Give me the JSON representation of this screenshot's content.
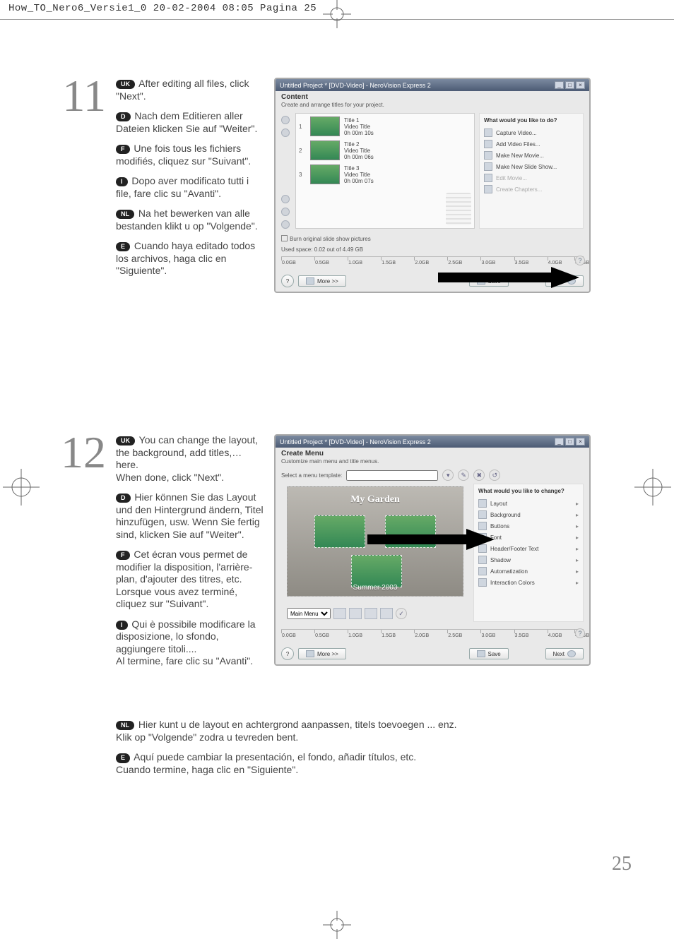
{
  "header": "How_TO_Nero6_Versie1_0   20-02-2004   08:05   Pagina 25",
  "page_number": "25",
  "step11": {
    "number": "11",
    "uk": "After editing all files, click \"Next\".",
    "d": "Nach dem Editieren aller Dateien klicken Sie auf \"Weiter\".",
    "f": "Une fois tous les fichiers modifiés, cliquez sur \"Suivant\".",
    "i": "Dopo aver modificato tutti i file, fare clic su \"Avanti\".",
    "nl": "Na het bewerken van alle bestanden klikt u op \"Volgende\".",
    "e": "Cuando haya editado todos los archivos, haga clic en \"Siguiente\"."
  },
  "shot1": {
    "title": "Untitled Project * [DVD-Video] - NeroVision Express 2",
    "section_head": "Content",
    "section_sub": "Create and arrange titles for your project.",
    "clips": [
      {
        "idx": "1",
        "title": "Title 1",
        "sub": "Video Title",
        "dur": "0h 00m 10s"
      },
      {
        "idx": "2",
        "title": "Title 2",
        "sub": "Video Title",
        "dur": "0h 00m 06s"
      },
      {
        "idx": "3",
        "title": "Title 3",
        "sub": "Video Title",
        "dur": "0h 00m 07s"
      }
    ],
    "right_head": "What would you like to do?",
    "right_items": [
      {
        "label": "Capture Video...",
        "disabled": false
      },
      {
        "label": "Add Video Files...",
        "disabled": false
      },
      {
        "label": "Make New Movie...",
        "disabled": false
      },
      {
        "label": "Make New Slide Show...",
        "disabled": false
      },
      {
        "label": "Edit Movie...",
        "disabled": true
      },
      {
        "label": "Create Chapters...",
        "disabled": true
      }
    ],
    "burn_checkbox": "Burn original slide show pictures",
    "used_space": "Used space: 0.02 out of 4.49 GB",
    "ruler": [
      "0.0GB",
      "0.5GB",
      "1.0GB",
      "1.5GB",
      "2.0GB",
      "2.5GB",
      "3.0GB",
      "3.5GB",
      "4.0GB",
      "4.5GB"
    ],
    "btn_more": "More >>",
    "btn_save": "Save",
    "btn_next": "Next"
  },
  "step12": {
    "number": "12",
    "uk": "You can change the layout, the background, add titles,… here.\nWhen done, click \"Next\".",
    "d": "Hier können Sie das Layout und den Hintergrund ändern, Titel hinzufügen, usw. Wenn Sie fertig sind, klicken Sie auf \"Weiter\".",
    "f": "Cet écran vous permet de modifier la disposition, l'arrière-plan, d'ajouter des titres, etc. Lorsque vous avez terminé, cliquez sur \"Suivant\".",
    "i": "Qui è possibile modificare la disposizione, lo sfondo, aggiungere titoli....\nAl termine, fare clic su \"Avanti\".",
    "nl": "Hier kunt u de layout en achtergrond aanpassen, titels toevoegen ... enz.\nKlik op \"Volgende\" zodra u tevreden bent.",
    "e": "Aquí puede cambiar la presentación, el fondo, añadir títulos, etc.\nCuando termine, haga clic en \"Siguiente\"."
  },
  "shot2": {
    "title": "Untitled Project * [DVD-Video] - NeroVision Express 2",
    "section_head": "Create Menu",
    "section_sub": "Customize main menu and title menus.",
    "template_label": "Select a menu template:",
    "menu_title": "My Garden",
    "menu_footer": "Summer 2003",
    "right_head": "What would you like to change?",
    "right_items": [
      {
        "label": "Layout"
      },
      {
        "label": "Background"
      },
      {
        "label": "Buttons"
      },
      {
        "label": "Font"
      },
      {
        "label": "Header/Footer Text"
      },
      {
        "label": "Shadow"
      },
      {
        "label": "Automatization"
      },
      {
        "label": "Interaction Colors"
      }
    ],
    "nav_select": "Main Menu",
    "ruler": [
      "0.0GB",
      "0.5GB",
      "1.0GB",
      "1.5GB",
      "2.0GB",
      "2.5GB",
      "3.0GB",
      "3.5GB",
      "4.0GB",
      "4.5GB"
    ],
    "btn_more": "More >>",
    "btn_save": "Save",
    "btn_next": "Next"
  },
  "pills": {
    "uk": "UK",
    "d": "D",
    "f": "F",
    "i": "I",
    "nl": "NL",
    "e": "E"
  }
}
